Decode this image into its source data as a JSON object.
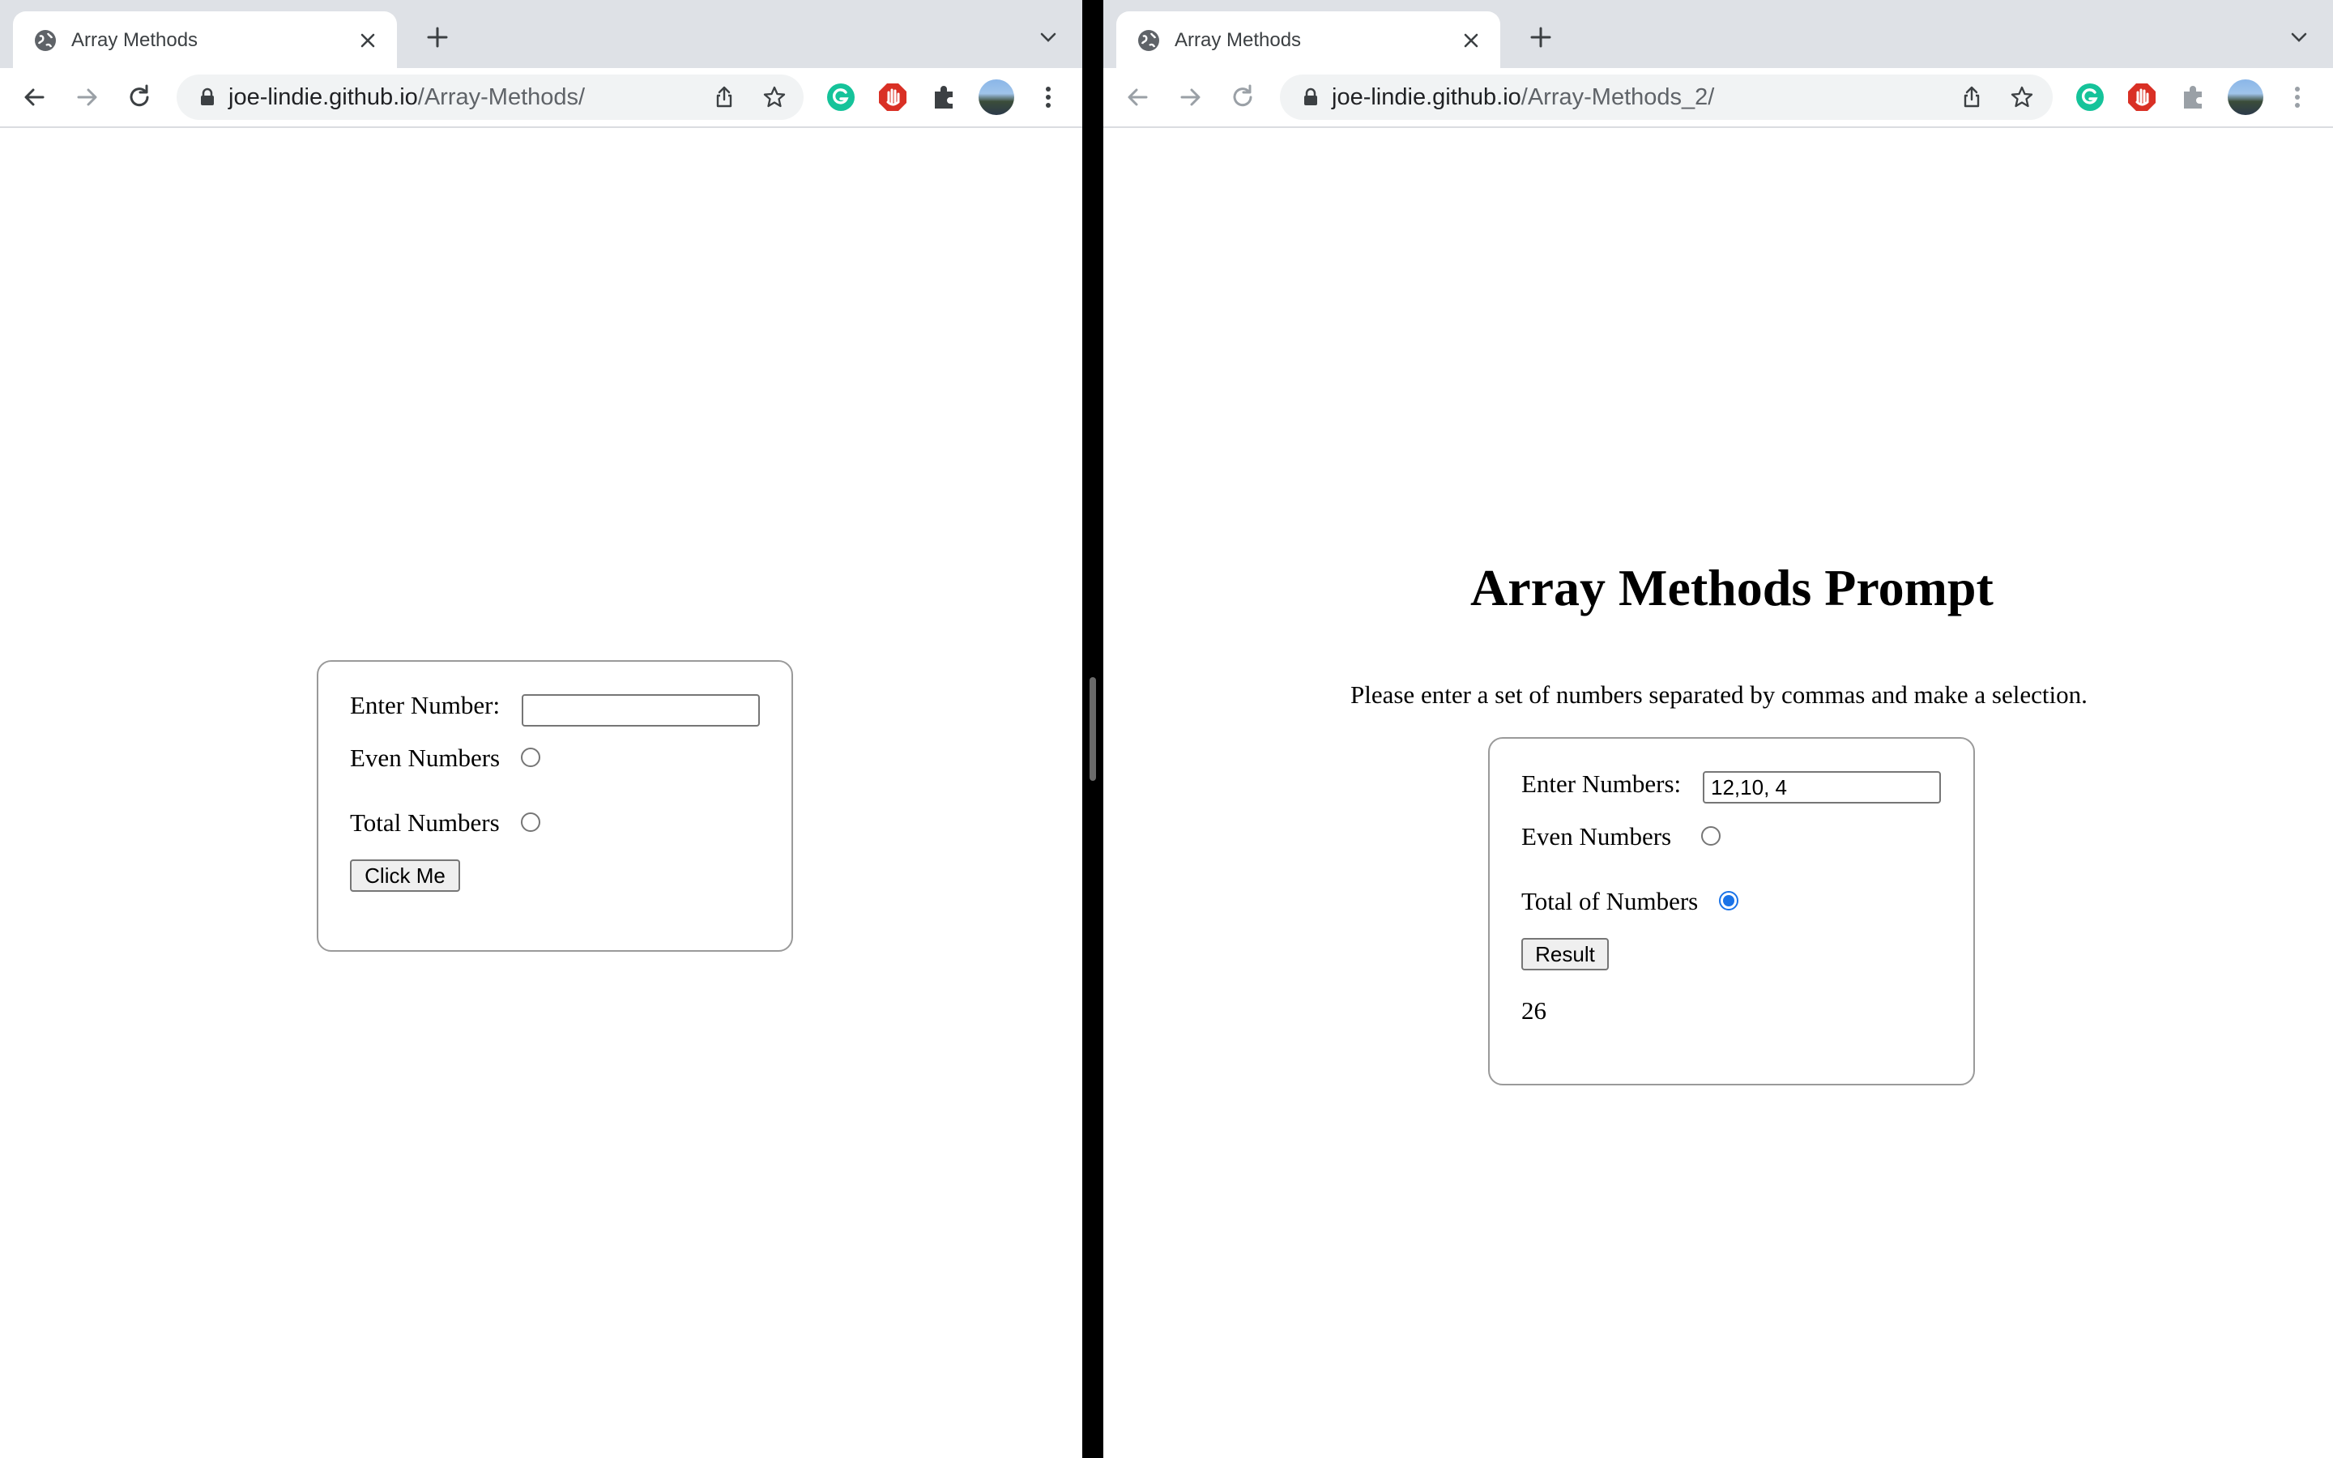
{
  "left_window": {
    "tab": {
      "title": "Array Methods"
    },
    "address_bar": {
      "host": "joe-lindie.github.io",
      "path": "/Array-Methods/"
    },
    "form": {
      "number_label": "Enter Number:",
      "number_value": "",
      "even_label": "Even Numbers",
      "even_checked": false,
      "total_label": "Total Numbers",
      "total_checked": false,
      "button_label": "Click Me"
    }
  },
  "right_window": {
    "tab": {
      "title": "Array Methods"
    },
    "address_bar": {
      "host": "joe-lindie.github.io",
      "path": "/Array-Methods_2/"
    },
    "heading": "Array Methods Prompt",
    "instructions": "Please enter a set of numbers separated by commas and make a selection.",
    "form": {
      "numbers_label": "Enter Numbers:",
      "numbers_value": "12,10, 4",
      "even_label": "Even Numbers",
      "even_checked": false,
      "total_label": "Total of Numbers",
      "total_checked": true,
      "button_label": "Result",
      "result_value": "26"
    }
  },
  "icons": {
    "favicon": "globe-icon",
    "close": "close-icon",
    "new_tab": "plus-icon",
    "tab_search": "chevron-down-icon",
    "back": "back-arrow-icon",
    "forward": "forward-arrow-icon",
    "reload": "reload-icon",
    "lock": "lock-icon",
    "share": "share-icon",
    "bookmark": "star-icon",
    "grammarly": "grammarly-icon",
    "adblock": "adblock-icon",
    "extensions": "puzzle-icon",
    "profile": "avatar",
    "menu": "kebab-menu-icon"
  },
  "colors": {
    "tabstrip": "#dee1e6",
    "omnibox": "#f1f3f4",
    "radio_checked": "#1a73e8",
    "grammarly": "#15c39a",
    "adblock": "#d93025"
  }
}
